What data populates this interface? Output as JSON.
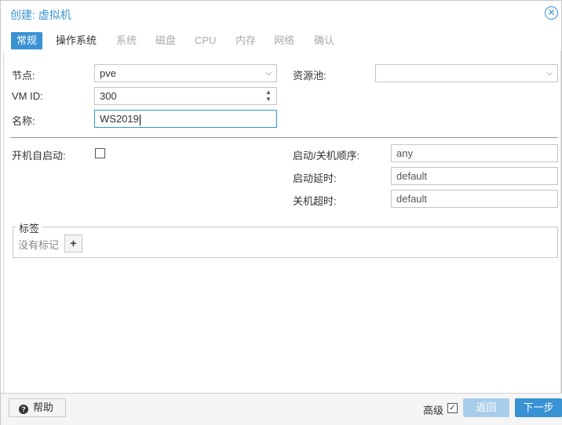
{
  "window": {
    "title": "创建: 虚拟机",
    "close_icon": "close-circle-icon"
  },
  "tabs": [
    "常规",
    "操作系统",
    "系统",
    "磁盘",
    "CPU",
    "内存",
    "网络",
    "确认"
  ],
  "general": {
    "node": {
      "label": "节点:",
      "value": "pve"
    },
    "vmid": {
      "label": "VM ID:",
      "value": "300"
    },
    "name": {
      "label": "名称:",
      "value": "WS2019"
    },
    "pool": {
      "label": "资源池:",
      "value": ""
    },
    "onboot": {
      "label": "开机自启动:",
      "checked": false
    },
    "startup_order": {
      "label": "启动/关机顺序:",
      "placeholder": "any"
    },
    "startup_delay": {
      "label": "启动延时:",
      "placeholder": "default"
    },
    "shutdown_timeout": {
      "label": "关机超时:",
      "placeholder": "default"
    }
  },
  "tags": {
    "legend": "标签",
    "empty_text": "没有标记",
    "add_icon": "plus-icon"
  },
  "footer": {
    "help_label": "帮助",
    "advanced_label": "高级",
    "advanced_checked": true,
    "back_label": "返回",
    "next_label": "下一步"
  },
  "colors": {
    "accent": "#3892d4",
    "disabled_button": "#a8cdeb"
  }
}
